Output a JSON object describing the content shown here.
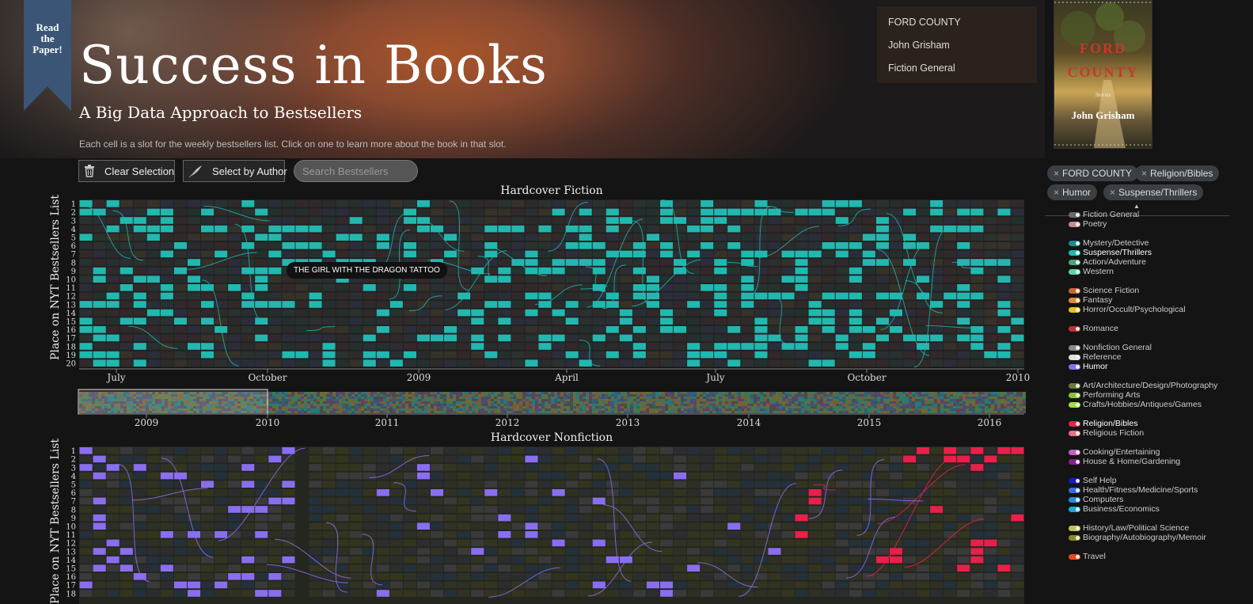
{
  "ribbon": {
    "lines": [
      "Read",
      "the",
      "Paper!"
    ]
  },
  "header": {
    "title": "Success in Books",
    "subtitle": "A Big Data Approach to Bestsellers",
    "instructions": "Each cell is a slot for the weekly bestsellers list. Click on one to learn more about the book in that slot."
  },
  "toolbar": {
    "clear_label": "Clear Selection",
    "author_label": "Select by Author",
    "search_placeholder": "Search Bestsellers"
  },
  "info_panel": {
    "title": "FORD COUNTY",
    "author": "John Grisham",
    "category": "Fiction General"
  },
  "cover": {
    "title_line1": "FORD",
    "title_line2": "COUNTY",
    "subtitle": "Stories",
    "author": "John Grisham"
  },
  "filters": [
    {
      "label": "FORD COUNTY"
    },
    {
      "label": "Religion/Bibles"
    },
    {
      "label": "Humor"
    },
    {
      "label": "Suspense/Thrillers"
    }
  ],
  "legend_scroll_arrow": "▲",
  "legend": [
    {
      "label": "Fiction General",
      "color": "#6a6a6a",
      "on": false
    },
    {
      "label": "Poetry",
      "color": "#c98a8a",
      "on": false
    },
    {
      "label": "Mystery/Detective",
      "color": "#1a8a8a",
      "on": false
    },
    {
      "label": "Suspense/Thrillers",
      "color": "#22b8b0",
      "on": true
    },
    {
      "label": "Action/Adventure",
      "color": "#4fa37a",
      "on": false
    },
    {
      "label": "Western",
      "color": "#5fd4a0",
      "on": false
    },
    {
      "label": "Science Fiction",
      "color": "#c8643a",
      "on": false
    },
    {
      "label": "Fantasy",
      "color": "#e08a3a",
      "on": false
    },
    {
      "label": "Horror/Occult/Psychological",
      "color": "#e8c020",
      "on": false
    },
    {
      "label": "Romance",
      "color": "#c03030",
      "on": false
    },
    {
      "label": "Nonfiction General",
      "color": "#8a8a8a",
      "on": false
    },
    {
      "label": "Reference",
      "color": "#e0e0e0",
      "on": false
    },
    {
      "label": "Humor",
      "color": "#8a6ef0",
      "on": true
    },
    {
      "label": "Art/Architecture/Design/Photography",
      "color": "#6a7a3a",
      "on": false
    },
    {
      "label": "Performing Arts",
      "color": "#8ac03a",
      "on": false
    },
    {
      "label": "Crafts/Hobbies/Antiques/Games",
      "color": "#a0e040",
      "on": false
    },
    {
      "label": "Religion/Bibles",
      "color": "#e8204a",
      "on": true
    },
    {
      "label": "Religious Fiction",
      "color": "#e87080",
      "on": false
    },
    {
      "label": "Cooking/Entertaining",
      "color": "#c060c0",
      "on": false
    },
    {
      "label": "House & Home/Gardening",
      "color": "#8a208a",
      "on": false
    },
    {
      "label": "Self Help",
      "color": "#1a1ac0",
      "on": false
    },
    {
      "label": "Health/Fitness/Medicine/Sports",
      "color": "#3a6ae0",
      "on": false
    },
    {
      "label": "Computers",
      "color": "#2a8ae0",
      "on": false
    },
    {
      "label": "Business/Economics",
      "color": "#1aaae0",
      "on": false
    },
    {
      "label": "History/Law/Political Science",
      "color": "#c0c060",
      "on": false
    },
    {
      "label": "Biography/Autobiography/Memoir",
      "color": "#8a8a2a",
      "on": false
    },
    {
      "label": "Travel",
      "color": "#e84a1a",
      "on": false
    }
  ],
  "fiction_chart": {
    "title": "Hardcover Fiction",
    "ylabel": "Place on NYT Bestsellers List",
    "ranks": [
      "1",
      "2",
      "3",
      "4",
      "5",
      "6",
      "7",
      "8",
      "9",
      "10",
      "11",
      "12",
      "13",
      "14",
      "15",
      "16",
      "17",
      "18",
      "19",
      "20"
    ],
    "x_ticks": [
      "July",
      "October",
      "2009",
      "April",
      "July",
      "October",
      "2010"
    ],
    "tooltip": "THE GIRL WITH THE DRAGON TATTOO",
    "highlight_color": "#22b8b0"
  },
  "timeline": {
    "years": [
      "2009",
      "2010",
      "2011",
      "2012",
      "2013",
      "2014",
      "2015",
      "2016"
    ]
  },
  "nonfiction_chart": {
    "title": "Hardcover Nonfiction",
    "ylabel": "Place on NYT Bestsellers List",
    "ranks": [
      "1",
      "2",
      "3",
      "4",
      "5",
      "6",
      "7",
      "8",
      "9",
      "10",
      "11",
      "12",
      "13",
      "14",
      "15",
      "16",
      "17",
      "18"
    ],
    "humor_color": "#8a6ef0",
    "religion_color": "#e8204a"
  }
}
